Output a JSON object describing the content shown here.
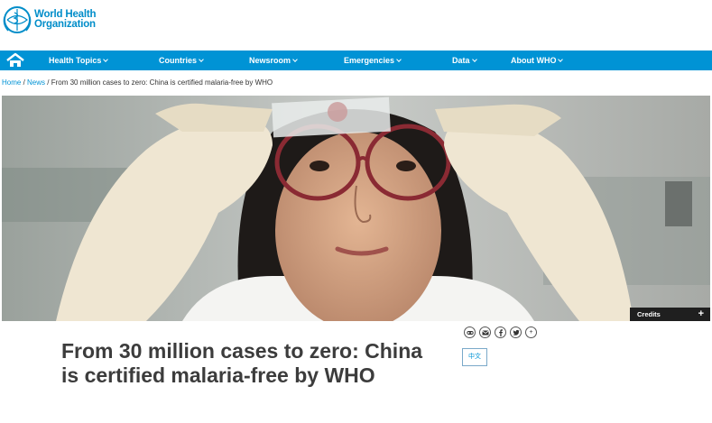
{
  "logo": {
    "line1": "World Health",
    "line2": "Organization"
  },
  "nav": {
    "items": [
      {
        "label": "Health Topics"
      },
      {
        "label": "Countries"
      },
      {
        "label": "Newsroom"
      },
      {
        "label": "Emergencies"
      },
      {
        "label": "Data"
      },
      {
        "label": "About WHO"
      }
    ]
  },
  "breadcrumb": {
    "home": "Home",
    "sep1": " / ",
    "news": "News",
    "sep2": " / ",
    "current": "From 30 million cases to zero: China is certified malaria-free by WHO"
  },
  "hero": {
    "credits_label": "Credits",
    "credits_plus": "+"
  },
  "article": {
    "title": "From 30 million cases to zero: China is certified malaria-free by WHO",
    "language_button": "中文"
  },
  "share": {
    "plus": "+"
  },
  "colors": {
    "brand_blue": "#0093d5",
    "logo_blue": "#008dc9",
    "headline": "#3c3c3c"
  }
}
